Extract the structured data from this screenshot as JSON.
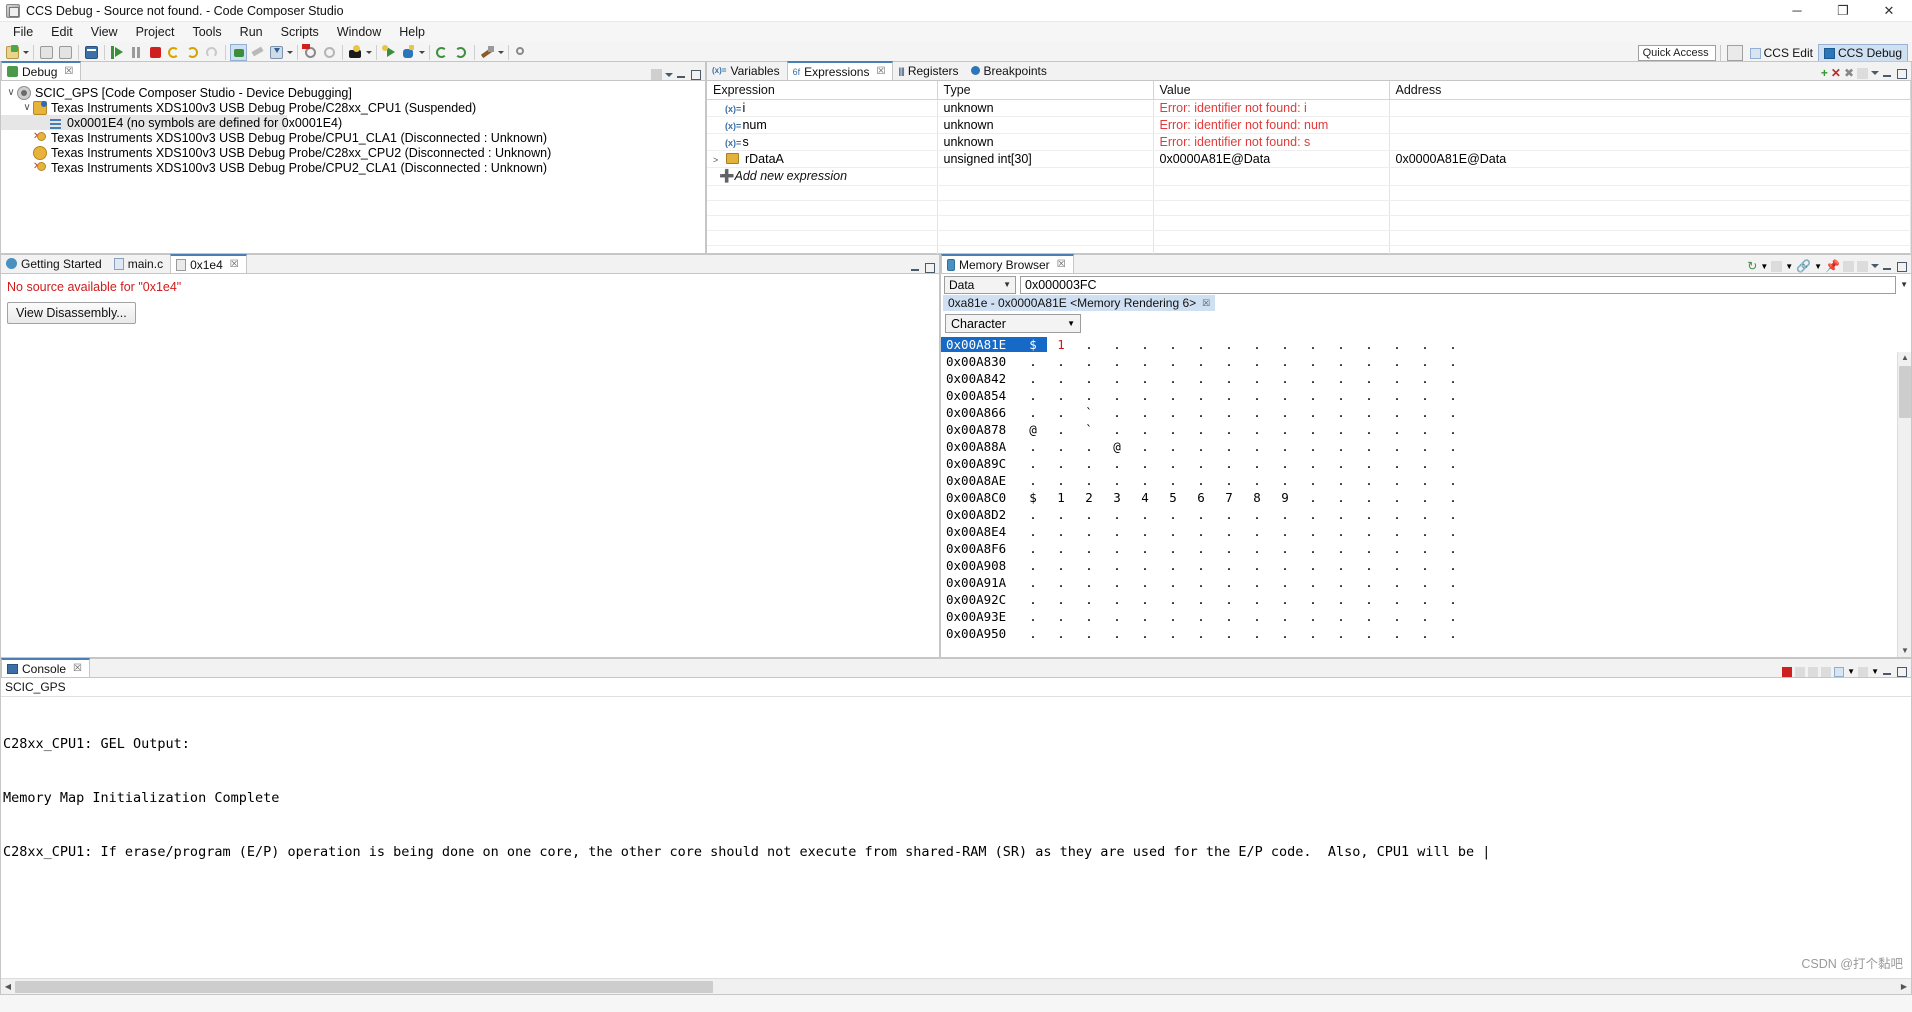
{
  "window": {
    "title": "CCS Debug - Source not found. - Code Composer Studio",
    "minimize_label": "─",
    "maximize_label": "❐",
    "close_label": "✕"
  },
  "menu": {
    "items": [
      "File",
      "Edit",
      "View",
      "Project",
      "Tools",
      "Run",
      "Scripts",
      "Window",
      "Help"
    ]
  },
  "quick_access": {
    "placeholder": "Quick Access",
    "value": "Quick Access"
  },
  "perspectives": [
    {
      "label": "CCS Edit",
      "active": false
    },
    {
      "label": "CCS Debug",
      "active": true
    }
  ],
  "debug_view": {
    "tab_label": "Debug",
    "tab_close": "☒",
    "tree": [
      {
        "indent": 0,
        "twisty": "∨",
        "icon": "project-icon",
        "label": "SCIC_GPS [Code Composer Studio - Device Debugging]",
        "selected": false
      },
      {
        "indent": 1,
        "twisty": "∨",
        "icon": "thread-icon",
        "label": "Texas Instruments XDS100v3 USB Debug Probe/C28xx_CPU1 (Suspended)",
        "selected": false
      },
      {
        "indent": 2,
        "twisty": "",
        "icon": "stackframe-icon",
        "label": "0x0001E4  (no symbols are defined for 0x0001E4)",
        "selected": true
      },
      {
        "indent": 1,
        "twisty": "",
        "icon": "thread-disconnected-icon",
        "label": "Texas Instruments XDS100v3 USB Debug Probe/CPU1_CLA1 (Disconnected : Unknown)",
        "selected": false
      },
      {
        "indent": 1,
        "twisty": "",
        "icon": "thread-disconnected-icon",
        "label": "Texas Instruments XDS100v3 USB Debug Probe/C28xx_CPU2 (Disconnected : Unknown)",
        "selected": false
      },
      {
        "indent": 1,
        "twisty": "",
        "icon": "thread-disconnected-icon",
        "label": "Texas Instruments XDS100v3 USB Debug Probe/CPU2_CLA1 (Disconnected : Unknown)",
        "selected": false
      }
    ]
  },
  "expressions_view": {
    "tabs": [
      {
        "label": "Variables",
        "icon": "variable-icon",
        "active": false
      },
      {
        "label": "Expressions",
        "icon": "expression-icon",
        "active": true
      },
      {
        "label": "Registers",
        "icon": "register-icon",
        "active": false
      },
      {
        "label": "Breakpoints",
        "icon": "breakpoint-icon",
        "active": false
      }
    ],
    "columns": [
      "Expression",
      "Type",
      "Value",
      "Address"
    ],
    "rows": [
      {
        "expression": "i",
        "type": "unknown",
        "value": "Error: identifier not found: i",
        "address": "",
        "error": true,
        "expandable": false,
        "icon": "variable-icon"
      },
      {
        "expression": "num",
        "type": "unknown",
        "value": "Error: identifier not found: num",
        "address": "",
        "error": true,
        "expandable": false,
        "icon": "variable-icon"
      },
      {
        "expression": "s",
        "type": "unknown",
        "value": "Error: identifier not found: s",
        "address": "",
        "error": true,
        "expandable": false,
        "icon": "variable-icon"
      },
      {
        "expression": "rDataA",
        "type": "unsigned int[30]",
        "value": "0x0000A81E@Data",
        "address": "0x0000A81E@Data",
        "error": false,
        "expandable": true,
        "icon": "array-icon"
      }
    ],
    "add_new_expression": "Add new expression"
  },
  "editor_view": {
    "tabs": [
      {
        "label": "Getting Started",
        "icon": "getting-started-icon",
        "active": false,
        "closable": false
      },
      {
        "label": "main.c",
        "icon": "c-file-icon",
        "active": false,
        "closable": false
      },
      {
        "label": "0x1e4",
        "icon": "disassembly-icon",
        "active": true,
        "closable": true
      }
    ],
    "message": "No source available for \"0x1e4\"",
    "button_label": "View Disassembly..."
  },
  "memory_browser": {
    "tab_label": "Memory Browser",
    "tab_close": "☒",
    "memory_space": "Data",
    "address_value": "0x000003FC",
    "rendering_tab": "0xa81e - 0x0000A81E <Memory Rendering 6>",
    "rendering_tab_close": "☒",
    "format": "Character",
    "rows": [
      {
        "address": "0x00A81E",
        "selected": true,
        "cells": [
          "$",
          "1",
          ".",
          ".",
          ".",
          ".",
          ".",
          ".",
          ".",
          ".",
          ".",
          ".",
          ".",
          ".",
          ".",
          "."
        ]
      },
      {
        "address": "0x00A830",
        "selected": false,
        "cells": [
          ".",
          ".",
          ".",
          ".",
          ".",
          ".",
          ".",
          ".",
          ".",
          ".",
          ".",
          ".",
          ".",
          ".",
          ".",
          "."
        ]
      },
      {
        "address": "0x00A842",
        "selected": false,
        "cells": [
          ".",
          ".",
          ".",
          ".",
          ".",
          ".",
          ".",
          ".",
          ".",
          ".",
          ".",
          ".",
          ".",
          ".",
          ".",
          "."
        ]
      },
      {
        "address": "0x00A854",
        "selected": false,
        "cells": [
          ".",
          ".",
          ".",
          ".",
          ".",
          ".",
          ".",
          ".",
          ".",
          ".",
          ".",
          ".",
          ".",
          ".",
          ".",
          "."
        ]
      },
      {
        "address": "0x00A866",
        "selected": false,
        "cells": [
          ".",
          ".",
          "`",
          ".",
          ".",
          ".",
          ".",
          ".",
          ".",
          ".",
          ".",
          ".",
          ".",
          ".",
          ".",
          "."
        ]
      },
      {
        "address": "0x00A878",
        "selected": false,
        "cells": [
          "@",
          ".",
          "`",
          ".",
          ".",
          ".",
          ".",
          ".",
          ".",
          ".",
          ".",
          ".",
          ".",
          ".",
          ".",
          "."
        ]
      },
      {
        "address": "0x00A88A",
        "selected": false,
        "cells": [
          ".",
          ".",
          ".",
          "@",
          ".",
          ".",
          ".",
          ".",
          ".",
          ".",
          ".",
          ".",
          ".",
          ".",
          ".",
          "."
        ]
      },
      {
        "address": "0x00A89C",
        "selected": false,
        "cells": [
          ".",
          ".",
          ".",
          ".",
          ".",
          ".",
          ".",
          ".",
          ".",
          ".",
          ".",
          ".",
          ".",
          ".",
          ".",
          "."
        ]
      },
      {
        "address": "0x00A8AE",
        "selected": false,
        "cells": [
          ".",
          ".",
          ".",
          ".",
          ".",
          ".",
          ".",
          ".",
          ".",
          ".",
          ".",
          ".",
          ".",
          ".",
          ".",
          "."
        ]
      },
      {
        "address": "0x00A8C0",
        "selected": false,
        "cells": [
          "$",
          "1",
          "2",
          "3",
          "4",
          "5",
          "6",
          "7",
          "8",
          "9",
          ".",
          ".",
          ".",
          ".",
          ".",
          "."
        ]
      },
      {
        "address": "0x00A8D2",
        "selected": false,
        "cells": [
          ".",
          ".",
          ".",
          ".",
          ".",
          ".",
          ".",
          ".",
          ".",
          ".",
          ".",
          ".",
          ".",
          ".",
          ".",
          "."
        ]
      },
      {
        "address": "0x00A8E4",
        "selected": false,
        "cells": [
          ".",
          ".",
          ".",
          ".",
          ".",
          ".",
          ".",
          ".",
          ".",
          ".",
          ".",
          ".",
          ".",
          ".",
          ".",
          "."
        ]
      },
      {
        "address": "0x00A8F6",
        "selected": false,
        "cells": [
          ".",
          ".",
          ".",
          ".",
          ".",
          ".",
          ".",
          ".",
          ".",
          ".",
          ".",
          ".",
          ".",
          ".",
          ".",
          "."
        ]
      },
      {
        "address": "0x00A908",
        "selected": false,
        "cells": [
          ".",
          ".",
          ".",
          ".",
          ".",
          ".",
          ".",
          ".",
          ".",
          ".",
          ".",
          ".",
          ".",
          ".",
          ".",
          "."
        ]
      },
      {
        "address": "0x00A91A",
        "selected": false,
        "cells": [
          ".",
          ".",
          ".",
          ".",
          ".",
          ".",
          ".",
          ".",
          ".",
          ".",
          ".",
          ".",
          ".",
          ".",
          ".",
          "."
        ]
      },
      {
        "address": "0x00A92C",
        "selected": false,
        "cells": [
          ".",
          ".",
          ".",
          ".",
          ".",
          ".",
          ".",
          ".",
          ".",
          ".",
          ".",
          ".",
          ".",
          ".",
          ".",
          "."
        ]
      },
      {
        "address": "0x00A93E",
        "selected": false,
        "cells": [
          ".",
          ".",
          ".",
          ".",
          ".",
          ".",
          ".",
          ".",
          ".",
          ".",
          ".",
          ".",
          ".",
          ".",
          ".",
          "."
        ]
      },
      {
        "address": "0x00A950",
        "selected": false,
        "cells": [
          ".",
          ".",
          ".",
          ".",
          ".",
          ".",
          ".",
          ".",
          ".",
          ".",
          ".",
          ".",
          ".",
          ".",
          ".",
          "."
        ]
      }
    ]
  },
  "console_view": {
    "tab_label": "Console",
    "tab_close": "☒",
    "source_label": "SCIC_GPS",
    "lines": [
      "C28xx_CPU1: GEL Output: ",
      "Memory Map Initialization Complete",
      "C28xx_CPU1: If erase/program (E/P) operation is being done on one core, the other core should not execute from shared-RAM (SR) as they are used for the E/P code.  Also, CPU1 will be |"
    ]
  },
  "watermark": "CSDN @打个黏吧",
  "colors": {
    "accent": "#1669c6",
    "error": "#e23b3b",
    "tab_active_border": "#4a7fb5",
    "selection": "#cfe0f2"
  }
}
